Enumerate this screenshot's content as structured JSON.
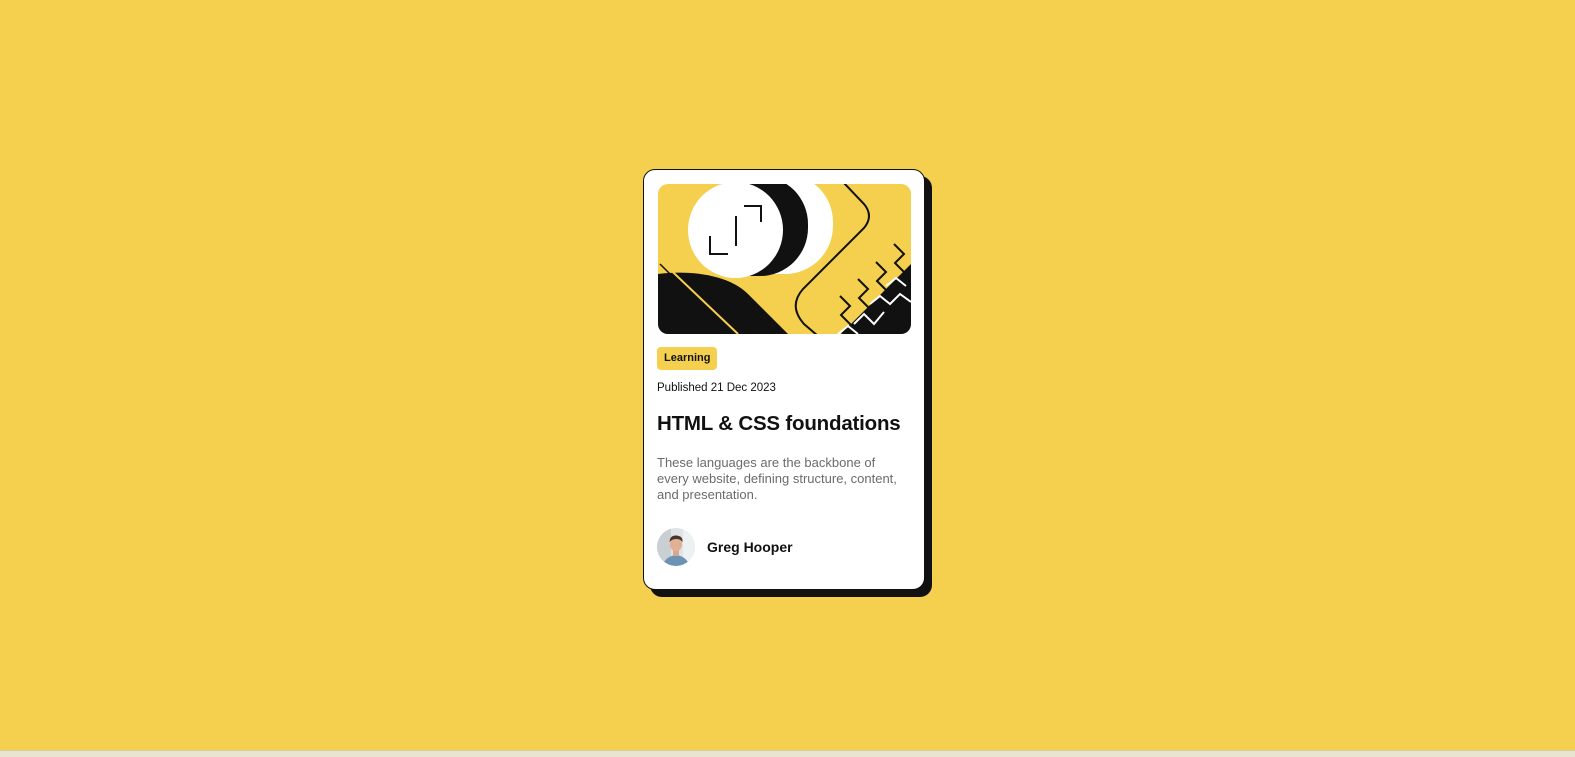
{
  "page": {
    "background_color": "#F4D04E"
  },
  "card": {
    "illustration": {
      "icon": "abstract-geometric-illustration"
    },
    "tag": "Learning",
    "published": "Published 21 Dec 2023",
    "title": "HTML & CSS foundations",
    "description": "These languages are the backbone of every website, defining structure, content, and presentation.",
    "author": {
      "name": "Greg Hooper",
      "avatar_icon": "author-avatar"
    }
  },
  "colors": {
    "accent": "#F4D04E",
    "text": "#111111",
    "muted": "#6B6B6B",
    "card": "#FFFFFF"
  }
}
